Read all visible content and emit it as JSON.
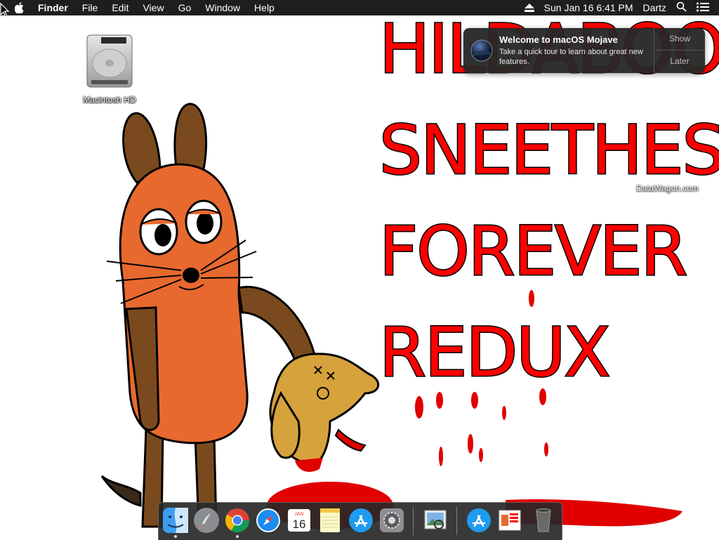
{
  "menubar": {
    "app_name": "Finder",
    "menus": [
      "File",
      "Edit",
      "View",
      "Go",
      "Window",
      "Help"
    ],
    "clock": "Sun Jan 16  6:41 PM",
    "user": "Dartz"
  },
  "desktop": {
    "drive_icon_label": "Macintosh HD",
    "image_text_lines": [
      "HILDABOO",
      "SNEETHES",
      "FOREVER",
      "REDUX"
    ],
    "watermark": "DataWagon.com"
  },
  "notification": {
    "title": "Welcome to macOS Mojave",
    "body": "Take a quick tour to learn about great new features.",
    "show_label": "Show",
    "later_label": "Later"
  },
  "dock": {
    "icons": [
      "finder-icon",
      "launchpad-icon",
      "chrome-icon",
      "safari-icon",
      "calendar-icon",
      "notes-icon",
      "app-store-icon",
      "system-preferences-icon",
      "preview-icon",
      "app-store-folder-icon",
      "image-document-icon",
      "trash-icon"
    ],
    "calendar_month": "JAN",
    "calendar_day": "16"
  },
  "colors": {
    "menubar_bg": "#1e1e1e",
    "text_red": "#ff0000",
    "mouse_orange": "#e8692e",
    "mouse_brown": "#7a4a1e",
    "dog_gold": "#d6a23c",
    "blood_red": "#e00000"
  }
}
